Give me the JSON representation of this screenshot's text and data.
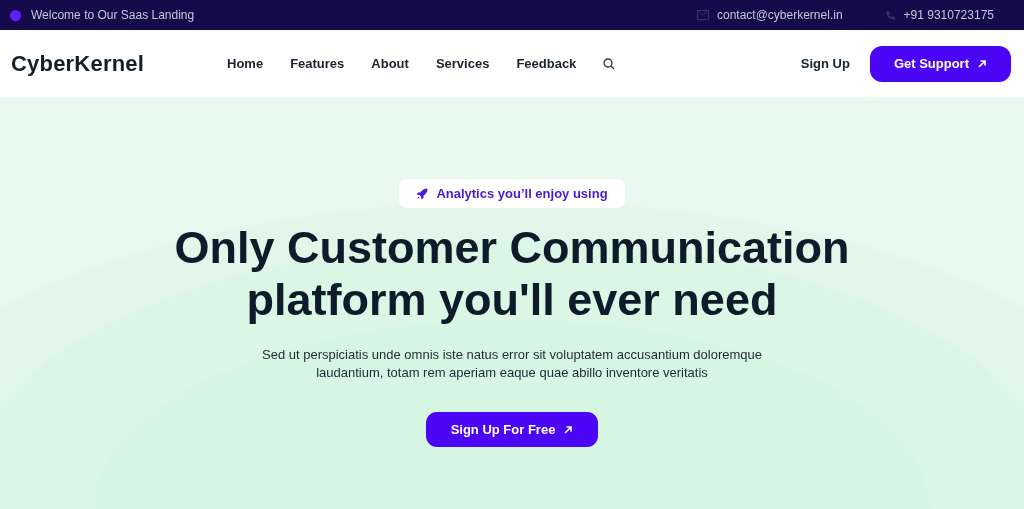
{
  "top_bar": {
    "welcome": "Welcome to Our Saas Landing",
    "email": "contact@cyberkernel.in",
    "phone": "+91 9310723175"
  },
  "nav": {
    "logo": "CyberKernel",
    "links": [
      {
        "label": "Home"
      },
      {
        "label": "Features"
      },
      {
        "label": "About"
      },
      {
        "label": "Services"
      },
      {
        "label": "Feedback"
      }
    ],
    "sign_up": "Sign Up",
    "cta": "Get Support"
  },
  "hero": {
    "badge": "Analytics you’ll enjoy using",
    "title_lines": [
      "Only Customer Communication",
      "platform you'll ever need"
    ],
    "text": "Sed ut perspiciatis unde omnis iste natus error sit voluptatem accusantium doloremque laudantium, totam rem aperiam eaque quae abillo inventore veritatis",
    "button": "Sign Up For Free"
  }
}
